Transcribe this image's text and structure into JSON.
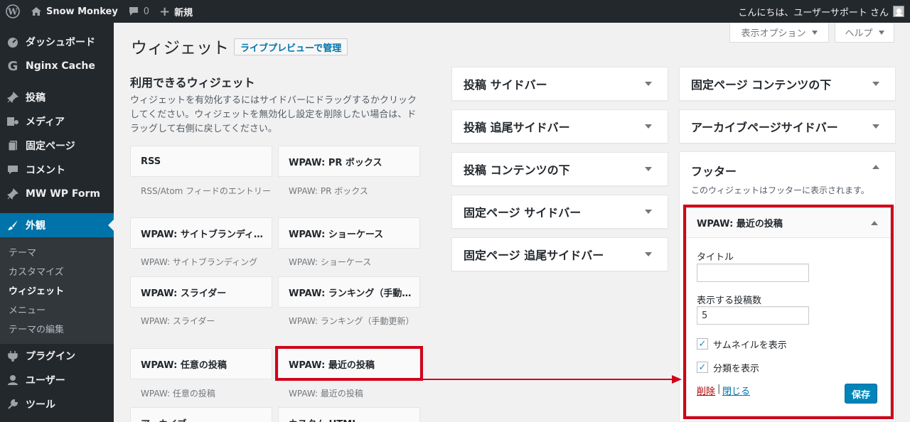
{
  "adminbar": {
    "site_name": "Snow Monkey",
    "comments_count": "0",
    "new_label": "新規",
    "greeting": "こんにちは、ユーザーサポート さん"
  },
  "sidebar": {
    "items": [
      {
        "label": "ダッシュボード",
        "icon": "dashboard-icon"
      },
      {
        "label": "Nginx Cache",
        "icon": "nginx-icon"
      },
      {
        "label": "投稿",
        "icon": "pin-icon"
      },
      {
        "label": "メディア",
        "icon": "media-icon"
      },
      {
        "label": "固定ページ",
        "icon": "page-icon"
      },
      {
        "label": "コメント",
        "icon": "comment-icon"
      },
      {
        "label": "MW WP Form",
        "icon": "pin-icon"
      },
      {
        "label": "外観",
        "icon": "brush-icon"
      },
      {
        "label": "プラグイン",
        "icon": "plugin-icon"
      },
      {
        "label": "ユーザー",
        "icon": "user-icon"
      },
      {
        "label": "ツール",
        "icon": "wrench-icon"
      }
    ],
    "submenu": [
      "テーマ",
      "カスタマイズ",
      "ウィジェット",
      "メニュー",
      "テーマの編集"
    ]
  },
  "screen_meta": {
    "options": "表示オプション",
    "help": "ヘルプ"
  },
  "page": {
    "title": "ウィジェット",
    "live_preview": "ライブプレビューで管理",
    "available_title": "利用できるウィジェット",
    "available_desc": "ウィジェットを有効化するにはサイドバーにドラッグするかクリックしてください。ウィジェットを無効化し設定を削除したい場合は、ドラッグして右側に戻してください。"
  },
  "widgets": [
    {
      "name": "RSS",
      "desc": "RSS/Atom フィードのエントリー"
    },
    {
      "name": "WPAW: PR ボックス",
      "desc": "WPAW: PR ボックス"
    },
    {
      "name": "WPAW: サイトブランディ…",
      "desc": "WPAW: サイトブランディング"
    },
    {
      "name": "WPAW: ショーケース",
      "desc": "WPAW: ショーケース"
    },
    {
      "name": "WPAW: スライダー",
      "desc": "WPAW: スライダー"
    },
    {
      "name": "WPAW: ランキング（手動…",
      "desc": "WPAW: ランキング（手動更新）"
    },
    {
      "name": "WPAW: 任意の投稿",
      "desc": "WPAW: 任意の投稿"
    },
    {
      "name": "WPAW: 最近の投稿",
      "desc": "WPAW: 最近の投稿"
    },
    {
      "name": "アーカイブ",
      "desc": ""
    },
    {
      "name": "カスタム HTML",
      "desc": ""
    }
  ],
  "sidebars_left": [
    "投稿 サイドバー",
    "投稿 追尾サイドバー",
    "投稿 コンテンツの下",
    "固定ページ サイドバー",
    "固定ページ 追尾サイドバー"
  ],
  "sidebars_right": [
    "固定ページ コンテンツの下",
    "アーカイブページサイドバー"
  ],
  "footer": {
    "title": "フッター",
    "desc": "このウィジェットはフッターに表示されます。",
    "widget": {
      "title": "WPAW: 最近の投稿",
      "title_label": "タイトル",
      "title_value": "",
      "count_label": "表示する投稿数",
      "count_value": "5",
      "thumb_label": "サムネイルを表示",
      "category_label": "分類を表示",
      "delete": "削除",
      "separator": "|",
      "close": "閉じる",
      "save": "保存"
    }
  },
  "colors": {
    "highlight": "#d0021b",
    "accent": "#0073aa",
    "adminbar": "#23282d"
  }
}
